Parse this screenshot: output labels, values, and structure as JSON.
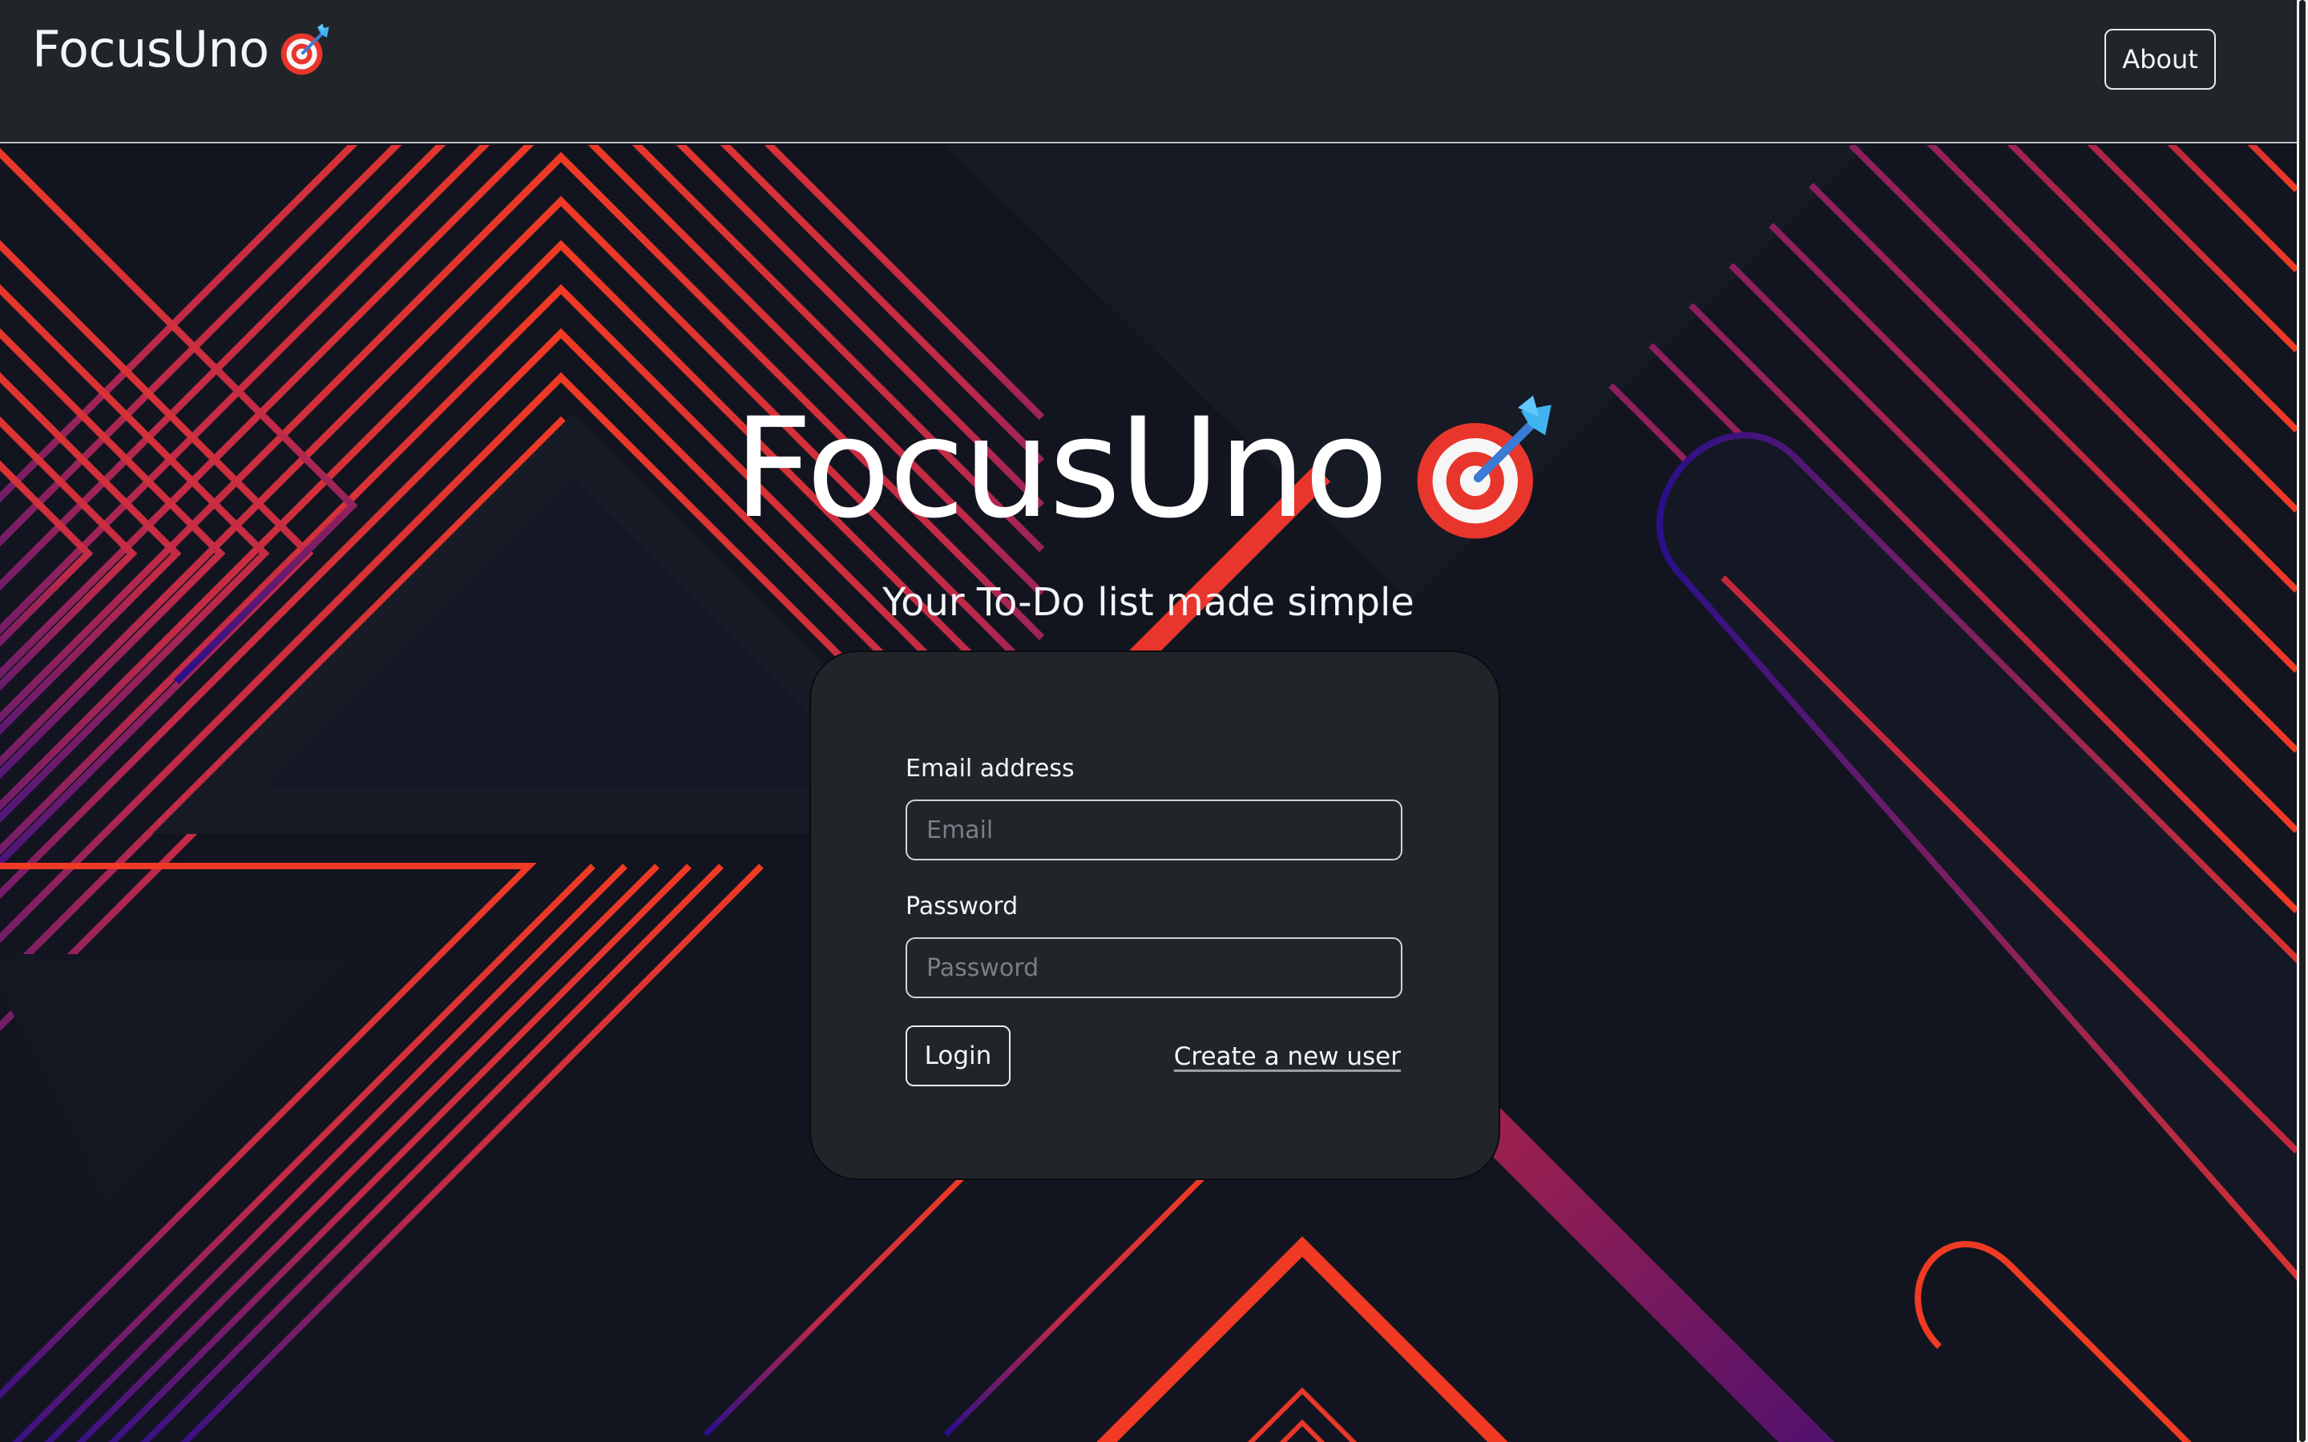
{
  "navbar": {
    "brand_text": "FocusUno",
    "brand_icon": "direct-hit-target-icon",
    "about_label": "About"
  },
  "hero": {
    "title": "FocusUno",
    "title_icon": "direct-hit-target-icon",
    "subtitle": "Your To-Do list made simple"
  },
  "login_form": {
    "email_label": "Email address",
    "email_placeholder": "Email",
    "email_value": "",
    "password_label": "Password",
    "password_placeholder": "Password",
    "password_value": "",
    "login_label": "Login",
    "create_user_label": "Create a new user"
  },
  "colors": {
    "navbar_bg": "#212529",
    "page_bg": "#12151f",
    "card_bg": "#212529",
    "accent_red": "#f03a24",
    "accent_purple": "#7a1f6e",
    "accent_indigo": "#2a0f8a"
  }
}
